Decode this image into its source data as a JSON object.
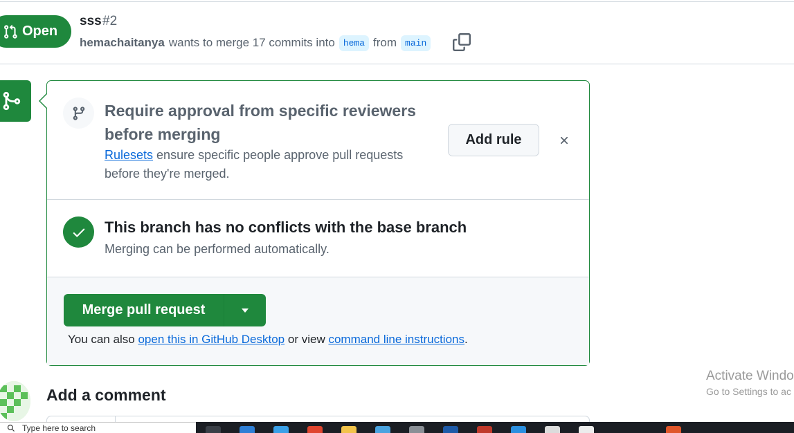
{
  "pull_request": {
    "state": "Open",
    "title": "sss",
    "number": "#2",
    "author": "hemachaitanya",
    "merge_text": "wants to merge 17 commits into",
    "base_branch": "hema",
    "from_text": "from",
    "head_branch": "main"
  },
  "ruleset_prompt": {
    "title": "Require approval from specific reviewers before merging",
    "link_text": "Rulesets",
    "description": "ensure specific people approve pull requests before they're merged.",
    "add_rule_label": "Add rule"
  },
  "conflict_check": {
    "title": "This branch has no conflicts with the base branch",
    "subtitle": "Merging can be performed automatically."
  },
  "merge_box": {
    "button_label": "Merge pull request",
    "alt_prefix": "You can also",
    "desktop_link": "open this in GitHub Desktop",
    "alt_middle": "or view",
    "cli_link": "command line instructions",
    "alt_suffix": "."
  },
  "comment": {
    "heading": "Add a comment"
  },
  "watermark": {
    "title": "Activate Windo",
    "subtitle": "Go to Settings to ac"
  },
  "taskbar": {
    "search_placeholder": "Type here to search"
  },
  "colors": {
    "success_green": "#1f883d",
    "link_blue": "#0969da",
    "branch_chip_bg": "#ddf4ff",
    "muted_text": "#59636e",
    "border": "#d0d7de"
  },
  "icons": {
    "state": "git-pull-request-icon",
    "copy": "copy-icon",
    "timeline": "git-merge-icon",
    "ruleset": "git-branch-icon",
    "dismiss": "close-icon",
    "check": "check-icon",
    "dropdown": "triangle-down-icon",
    "search": "search-icon"
  }
}
